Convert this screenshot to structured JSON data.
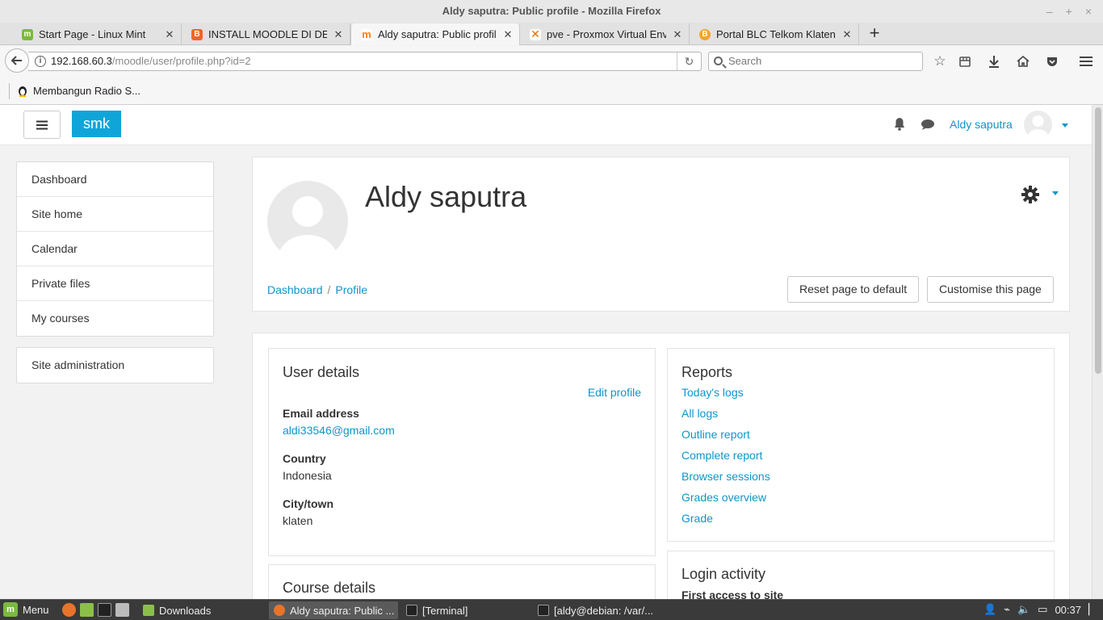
{
  "window": {
    "title": "Aldy saputra: Public profile - Mozilla Firefox",
    "controls": {
      "minimize": "–",
      "maximize": "+",
      "close": "×"
    }
  },
  "tabs": [
    {
      "label": "Start Page - Linux Mint",
      "favicon": "mint-icon",
      "color": "#7ab941",
      "active": false
    },
    {
      "label": "INSTALL MOODLE DI DEBIA",
      "favicon": "blogger-icon",
      "color": "#f26522",
      "active": false
    },
    {
      "label": "Aldy saputra: Public profile",
      "favicon": "moodle-icon",
      "color": "#f98012",
      "active": true
    },
    {
      "label": "pve - Proxmox Virtual Envir",
      "favicon": "proxmox-icon",
      "color": "#e57000",
      "active": false
    },
    {
      "label": "Portal BLC Telkom Klaten",
      "favicon": "blc-icon",
      "color": "#f5a623",
      "active": false
    }
  ],
  "navbar": {
    "url_host": "192.168.60.3",
    "url_path": "/moodle/user/profile.php?id=2",
    "search_placeholder": "Search"
  },
  "bookmarks": [
    {
      "label": "Membangun Radio S...",
      "icon": "tux-icon"
    }
  ],
  "moodle": {
    "brand": "smk",
    "header_user": "Aldy saputra",
    "nav_main": [
      "Dashboard",
      "Site home",
      "Calendar",
      "Private files",
      "My courses"
    ],
    "nav_admin": [
      "Site administration"
    ],
    "profile": {
      "name": "Aldy saputra",
      "breadcrumb": [
        "Dashboard",
        "Profile"
      ],
      "breadcrumb_sep": "/",
      "reset_button": "Reset page to default",
      "customise_button": "Customise this page"
    },
    "user_details": {
      "title": "User details",
      "edit_link": "Edit profile",
      "fields": [
        {
          "label": "Email address",
          "value": "aldi33546@gmail.com",
          "is_link": true
        },
        {
          "label": "Country",
          "value": "Indonesia",
          "is_link": false
        },
        {
          "label": "City/town",
          "value": "klaten",
          "is_link": false
        }
      ]
    },
    "course_details": {
      "title": "Course details"
    },
    "reports": {
      "title": "Reports",
      "links": [
        "Today's logs",
        "All logs",
        "Outline report",
        "Complete report",
        "Browser sessions",
        "Grades overview",
        "Grade"
      ]
    },
    "login_activity": {
      "title": "Login activity",
      "first_label": "First access to site"
    },
    "accent_color": "#0f95c8",
    "brand_color": "#0fa5d9"
  },
  "taskbar": {
    "menu_label": "Menu",
    "tasks": [
      {
        "label": "Downloads",
        "icon": "folder-icon",
        "active": false
      },
      {
        "label": "Aldy saputra: Public ...",
        "icon": "firefox-icon",
        "active": true
      },
      {
        "label": "[Terminal]",
        "icon": "terminal-icon",
        "active": false
      },
      {
        "label": "[aldy@debian: /var/...",
        "icon": "terminal-icon",
        "active": false
      }
    ],
    "clock": "00:37"
  }
}
